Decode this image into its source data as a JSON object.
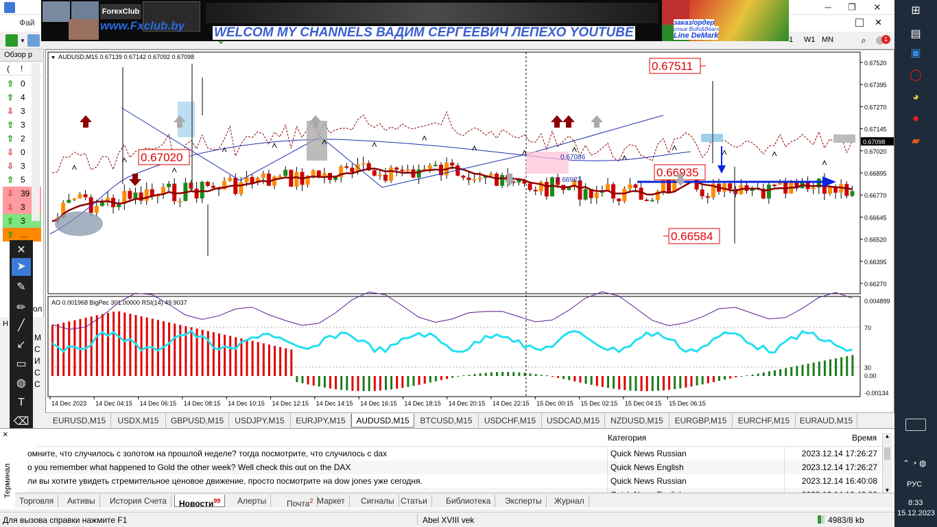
{
  "window": {
    "menu_first": "Фай",
    "min": "─",
    "restore": "❐",
    "close": "✕"
  },
  "banner": {
    "forexclub_logo": "ForexClub",
    "url": "www.Fxclub.by",
    "welcome": "WELCOM MY CHANNELS ВАДИМ СЕРГЕЕВИЧ ЛЕПЕХО YOUTUBE",
    "order": "заказ/ордер",
    "style": "стык Bulls&Bears",
    "line": "Line DeMark"
  },
  "toolbar": {
    "w1": "W1",
    "mn": "MN",
    "period_fragment": "1",
    "notif_count": "1"
  },
  "sidebar": {
    "title": "Обзор р",
    "head_left": "(",
    "head_right": "!",
    "rows": [
      {
        "dir": "up",
        "color": "#1a9a1a",
        "value": "0",
        "bg": "#ffffff"
      },
      {
        "dir": "up",
        "color": "#1a9a1a",
        "value": "4",
        "bg": "#ffffff"
      },
      {
        "dir": "down",
        "color": "#d44",
        "value": "3",
        "bg": "#ffffff"
      },
      {
        "dir": "up",
        "color": "#1a9a1a",
        "value": "3",
        "bg": "#ffffff"
      },
      {
        "dir": "up",
        "color": "#1a9a1a",
        "value": "2",
        "bg": "#ffffff"
      },
      {
        "dir": "down",
        "color": "#d44",
        "value": "0",
        "bg": "#ffffff"
      },
      {
        "dir": "down",
        "color": "#d44",
        "value": "3",
        "bg": "#ffffff"
      },
      {
        "dir": "up",
        "color": "#1a9a1a",
        "value": "5",
        "bg": "#ffffff"
      },
      {
        "dir": "down",
        "color": "#d44",
        "value": "39",
        "bg": "#ff9aa0"
      },
      {
        "dir": "down",
        "color": "#d44",
        "value": "3",
        "bg": "#ff9aa0"
      },
      {
        "dir": "up",
        "color": "#1a9a1a",
        "value": "3",
        "bg": "#7fe37f"
      },
      {
        "dir": "up",
        "color": "#1a9a1a",
        "value": "...",
        "bg": "#ff8800"
      }
    ],
    "term_hint": "Н",
    "letters": [
      "М",
      "С",
      "И",
      "С",
      "С"
    ],
    "tool_label": "ол"
  },
  "draw_tools": [
    "close-icon",
    "cursor-icon",
    "pencil-icon",
    "marker-icon",
    "line-icon",
    "arrow-icon",
    "rectangle-icon",
    "palette-icon",
    "text-icon",
    "eraser-icon",
    "checker-icon",
    "minus-icon",
    "resize-icon"
  ],
  "chart": {
    "header": "AUDUSD,M15  0.67139 0.67142 0.67092 0.67098",
    "indicator_header": "AO 0.001968  BigPec 301.00000  RSI(14) 49.9037",
    "price_labels": [
      "0.67520",
      "0.67395",
      "0.67270",
      "0.67145",
      "0.67020",
      "0.66895",
      "0.66770",
      "0.66645",
      "0.66520",
      "0.66395",
      "0.66270"
    ],
    "current_price": "0.67098",
    "ind_labels": [
      "0.004899",
      "70",
      "30",
      "0.00",
      "-0.00134"
    ],
    "time_labels": [
      "14 Dec 2023",
      "14 Dec 04:15",
      "14 Dec 06:15",
      "14 Dec 08:15",
      "14 Dec 10:15",
      "14 Dec 12:15",
      "14 Dec 14:15",
      "14 Dec 16:15",
      "14 Dec 18:15",
      "14 Dec 20:15",
      "14 Dec 22:15",
      "15 Dec 00:15",
      "15 Dec 02:15",
      "15 Dec 04:15",
      "15 Dec 06:15"
    ],
    "level_top": "0.67511",
    "level_left": "0.67020",
    "level_mid": "0.66935",
    "level_bottom": "0.66584",
    "small_label_1": "0.66923",
    "small_label_2": "0.67086"
  },
  "chart_tabs": [
    "EURUSD,M15",
    "USDX,M15",
    "GBPUSD,M15",
    "USDJPY,M15",
    "EURJPY,M15",
    "AUDUSD,M15",
    "BTCUSD,M15",
    "USDCHF,M15",
    "USDCAD,M15",
    "NZDUSD,M15",
    "EURGBP,M15",
    "EURCHF,M15",
    "EURAUD,M15"
  ],
  "active_chart_tab": "AUDUSD,M15",
  "terminal": {
    "col_category": "Категория",
    "col_time": "Время",
    "close": "×",
    "side_label": "Терминал",
    "rows": [
      {
        "msg": "омните, что случилось с золотом на прошлой неделе? тогда посмотрите, что случилось с dax",
        "cat": "Quick News Russian",
        "time": "2023.12.14 17:26:27"
      },
      {
        "msg": "o you remember what happened to Gold the other week? Well check this out on the DAX",
        "cat": "Quick News English",
        "time": "2023.12.14 17:26:27"
      },
      {
        "msg": "ли вы хотите увидеть стремительное ценовое движение, просто посмотрите на dow jones уже сегодня.",
        "cat": "Quick News Russian",
        "time": "2023.12.14 16:40:08"
      },
      {
        "msg": "",
        "cat": "Quick News English",
        "time": "2023.12.14 16:40:08"
      }
    ],
    "tabs": [
      {
        "label": "Торговля",
        "badge": ""
      },
      {
        "label": "Активы",
        "badge": ""
      },
      {
        "label": "История Счета",
        "badge": ""
      },
      {
        "label": "Новости",
        "badge": "99"
      },
      {
        "label": "Алерты",
        "badge": ""
      },
      {
        "label": "Почта",
        "badge": "2"
      },
      {
        "label": "Маркет",
        "badge": ""
      },
      {
        "label": "Сигналы",
        "badge": ""
      },
      {
        "label": "Статьи",
        "badge": ""
      },
      {
        "label": "Библиотека",
        "badge": ""
      },
      {
        "label": "Эксперты",
        "badge": ""
      },
      {
        "label": "Журнал",
        "badge": ""
      }
    ],
    "active_tab": "Новости"
  },
  "status": {
    "help": "Для вызова справки нажмите F1",
    "profile": "Abel XVIII vek",
    "traffic": "4983/8 kb"
  },
  "taskbar": {
    "lang": "РУС",
    "time": "8:33",
    "date": "15.12.2023",
    "icons": [
      "windows-icon",
      "files-icon",
      "gallery-icon",
      "opera-icon",
      "paint-icon",
      "record-icon",
      "powerpoint-icon"
    ]
  },
  "colors": {
    "bull": "#ff8c00",
    "bear": "#cc0000",
    "ao_up": "#1a7a1a",
    "ao_down": "#e00000",
    "rsi": "#22e0f0",
    "ma": "#8b0000",
    "trend": "#1f2fb0",
    "level_red": "#e00000",
    "blue_arrow": "#0a24e0"
  }
}
